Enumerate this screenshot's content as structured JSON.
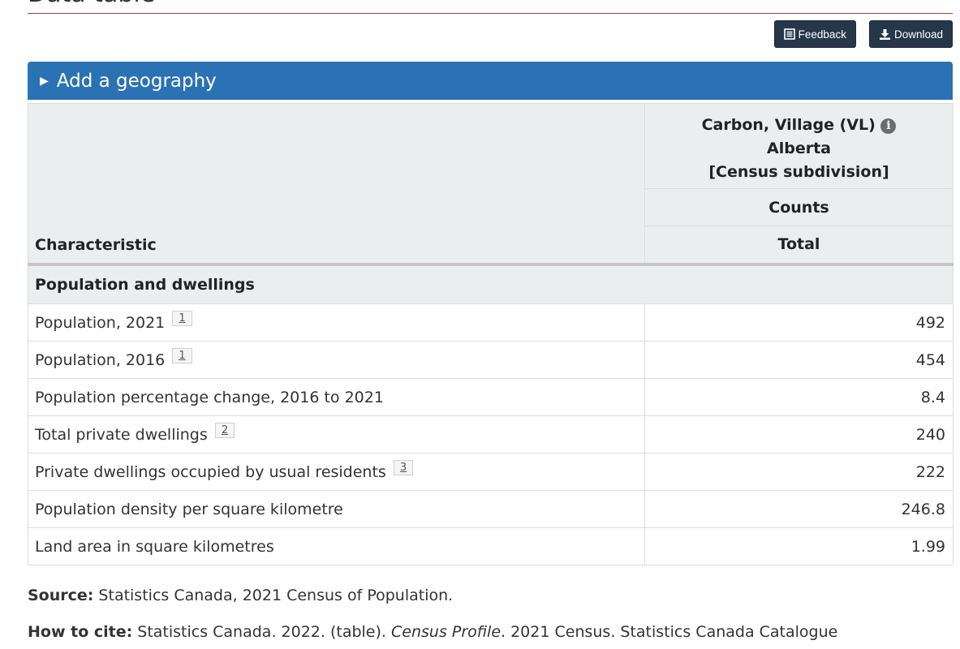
{
  "page": {
    "heading": "Data table"
  },
  "toolbar": {
    "feedback_label": "Feedback",
    "download_label": "Download"
  },
  "geography": {
    "toggle_label": "Add a geography"
  },
  "table": {
    "characteristic_header": "Characteristic",
    "geo_name": "Carbon, Village (VL)",
    "province": "Alberta",
    "geo_type": "[Census subdivision]",
    "counts_header": "Counts",
    "total_header": "Total",
    "section": "Population and dwellings",
    "rows": [
      {
        "label": "Population, 2021",
        "footnote": "1",
        "value": "492"
      },
      {
        "label": "Population, 2016",
        "footnote": "1",
        "value": "454"
      },
      {
        "label": "Population percentage change, 2016 to 2021",
        "value": "8.4"
      },
      {
        "label": "Total private dwellings",
        "footnote": "2",
        "value": "240"
      },
      {
        "label": "Private dwellings occupied by usual residents",
        "footnote": "3",
        "value": "222"
      },
      {
        "label": "Population density per square kilometre",
        "value": "246.8"
      },
      {
        "label": "Land area in square kilometres",
        "value": "1.99"
      }
    ]
  },
  "source": {
    "label": "Source:",
    "text": " Statistics Canada, 2021 Census of Population."
  },
  "cite": {
    "label": "How to cite:",
    "text1": " Statistics Canada. 2022. (table). ",
    "title": "Census Profile",
    "text2": ". 2021 Census. Statistics Canada Catalogue"
  },
  "colors": {
    "accent": "#2b72b5",
    "button_bg": "#26374a",
    "header_bg": "#ebeeee",
    "rule": "#af3c43"
  }
}
